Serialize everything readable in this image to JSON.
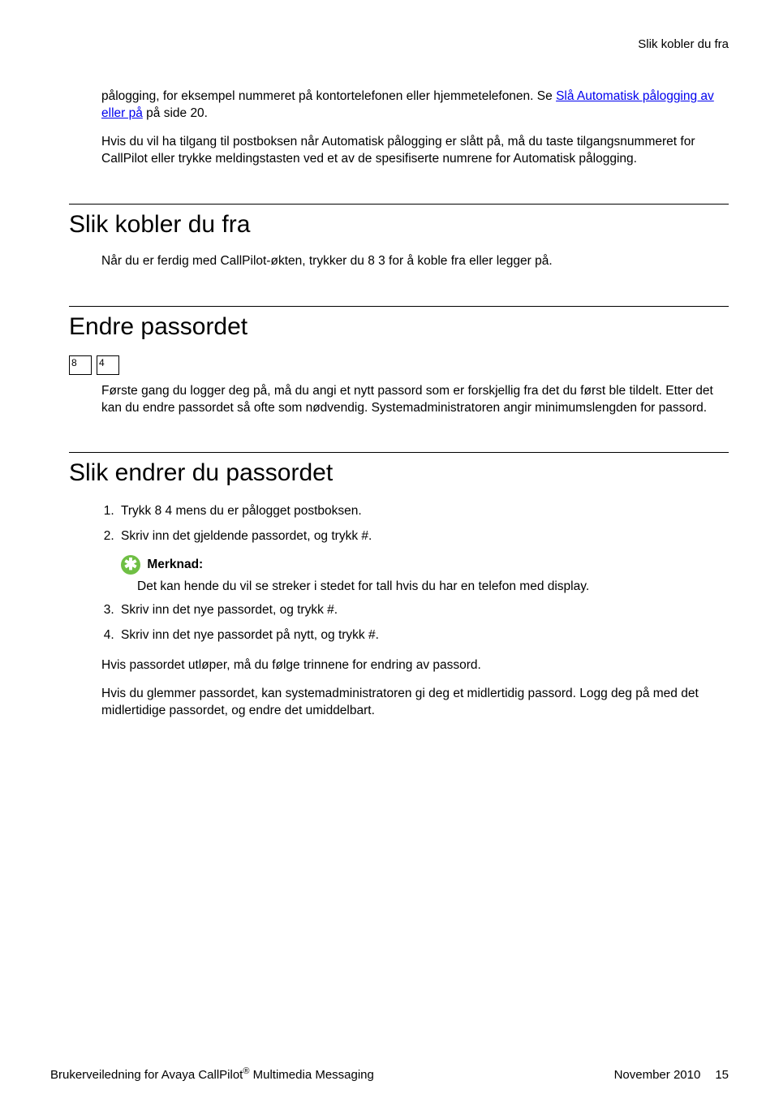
{
  "header": {
    "section_title": "Slik kobler du fra"
  },
  "intro": {
    "p1_pre": "pålogging, for eksempel nummeret på kontortelefonen eller hjemmetelefonen. Se ",
    "p1_link": "Slå Automatisk pålogging av eller på",
    "p1_post": " på side 20.",
    "p2": "Hvis du vil ha tilgang til postboksen når Automatisk pålogging er slått på, må du taste tilgangsnummeret for CallPilot eller trykke meldingstasten ved et av de spesifiserte numrene for Automatisk pålogging."
  },
  "sec1": {
    "title": "Slik kobler du fra",
    "p1": "Når du er ferdig med CallPilot-økten, trykker du 8 3 for å koble fra eller legger på."
  },
  "sec2": {
    "title": "Endre passordet",
    "key1": "8",
    "key2": "4",
    "p1": "Første gang du logger deg på, må du angi et nytt passord som er forskjellig fra det du først ble tildelt. Etter det kan du endre passordet så ofte som nødvendig. Systemadministratoren angir minimumslengden for passord."
  },
  "sec3": {
    "title": "Slik endrer du passordet",
    "step1": "Trykk 8 4 mens du er pålogget postboksen.",
    "step2": "Skriv inn det gjeldende passordet, og trykk #.",
    "note_label": "Merknad:",
    "note_text": "Det kan hende du vil se streker i stedet for tall hvis du har en telefon med display.",
    "step3": "Skriv inn det nye passordet, og trykk #.",
    "step4": "Skriv inn det nye passordet på nytt, og trykk #.",
    "p_after1": "Hvis passordet utløper, må du følge trinnene for endring av passord.",
    "p_after2": "Hvis du glemmer passordet, kan systemadministratoren gi deg et midlertidig passord. Logg deg på med det midlertidige passordet, og endre det umiddelbart."
  },
  "footer": {
    "left_pre": "Brukerveiledning for Avaya CallPilot",
    "left_sup": "®",
    "left_post": " Multimedia Messaging",
    "date": "November 2010",
    "page": "15"
  }
}
